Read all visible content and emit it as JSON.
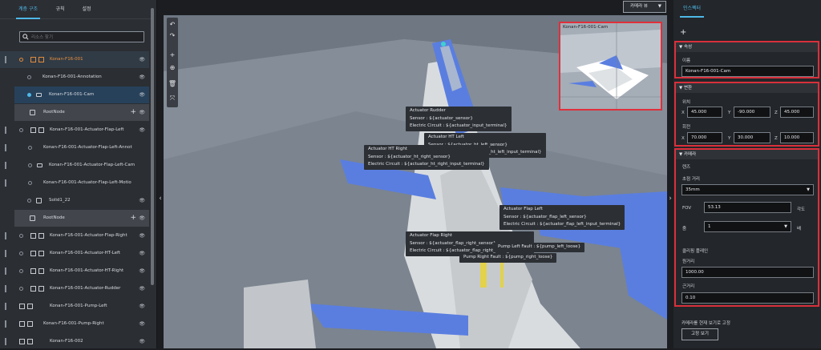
{
  "left_panel": {
    "tabs": [
      "계층 구조",
      "규칙",
      "설정"
    ],
    "search_placeholder": "리소스 찾기",
    "tree": [
      {
        "label": "Konan-F16-001",
        "state": "selected"
      },
      {
        "label": "Konan-F16-001-Annotation"
      },
      {
        "label": "Konan-F16-001-Cam",
        "state": "camera-selected"
      },
      {
        "label": "RootNode",
        "state": "root"
      },
      {
        "label": "Konan-F16-001-Actuator-Flap-Left"
      },
      {
        "label": "Konan-F16-001-Actuator-Flap-Left-Annot"
      },
      {
        "label": "Konan-F16-001-Actuator-Flap-Left-Cam"
      },
      {
        "label": "Konan-F16-001-Actuator-Flap-Left-Motio"
      },
      {
        "label": "Solid1_22"
      },
      {
        "label": "RootNode",
        "state": "root"
      },
      {
        "label": "Konan-F16-001-Actuator-Flap-Right"
      },
      {
        "label": "Konan-F16-001-Actuator-HT-Left"
      },
      {
        "label": "Konan-F16-001-Actuator-HT-Right"
      },
      {
        "label": "Konan-F16-001-Actuator-Rudder"
      },
      {
        "label": "Konan-F16-001-Pump-Left"
      },
      {
        "label": "Konan-F16-001-Pump-Right"
      },
      {
        "label": "Konan-F16-002"
      }
    ]
  },
  "viewport": {
    "camera_view_button": "카메라 뷰",
    "pip_title": "Konan-F16-001-Cam",
    "tooltips": [
      {
        "title": "Actuator Rudder",
        "l1": "Sensor : ${actuator_sensor}",
        "l2": "Electric Circuit : ${actuator_input_terminal}"
      },
      {
        "title": "Actuator HT Left",
        "l1": "Sensor : ${actuator_ht_left_sensor}",
        "l2": "Electric Circuit : ${actuator_ht_left_input_terminal}"
      },
      {
        "title": "Actuator HT Right",
        "l1": "Sensor : ${actuator_ht_right_sensor}",
        "l2": "Electric Circuit : ${actuator_ht_right_input_terminal}"
      },
      {
        "title": "Actuator Flap Left",
        "l1": "Sensor : ${actuator_flap_left_sensor}",
        "l2": "Electric Circuit : ${actuator_flap_left_input_terminal}"
      },
      {
        "title": "Actuator Flap Right",
        "l1": "Sensor : ${actuator_flap_right_sensor}",
        "l2": "Electric Circuit : ${actuator_flap_right_input_terminal}"
      },
      {
        "title": "Pump Left Fault : ${pump_left_loose}"
      },
      {
        "title": "Pump Right Fault : ${pump_right_loose}"
      }
    ]
  },
  "inspector": {
    "tab": "인스펙터",
    "props": {
      "head": "속성",
      "name_label": "이름",
      "name_value": "Konan-F16-001-Cam"
    },
    "transform": {
      "head": "변환",
      "position_label": "위치",
      "rotation_label": "회전",
      "position": {
        "x": "45.000",
        "y": "-90.000",
        "z": "45.000"
      },
      "rotation": {
        "x": "70.000",
        "y": "30.000",
        "z": "10.000"
      }
    },
    "camera": {
      "head": "카메라",
      "lens_label": "렌즈",
      "focal_label": "초점 거리",
      "focal_value": "35mm",
      "fov_label": "FOV",
      "fov_value": "53.13",
      "fov_unit": "각도",
      "zoom_label": "줌",
      "zoom_value": "1",
      "zoom_unit": "배",
      "clip_label": "클리핑 플레인",
      "far_label": "원거리",
      "far_value": "1000.00",
      "near_label": "근거리",
      "near_value": "0.10"
    },
    "fix_label": "카메라를 현재 보기로 고정",
    "fix_button": "고정 보기"
  }
}
